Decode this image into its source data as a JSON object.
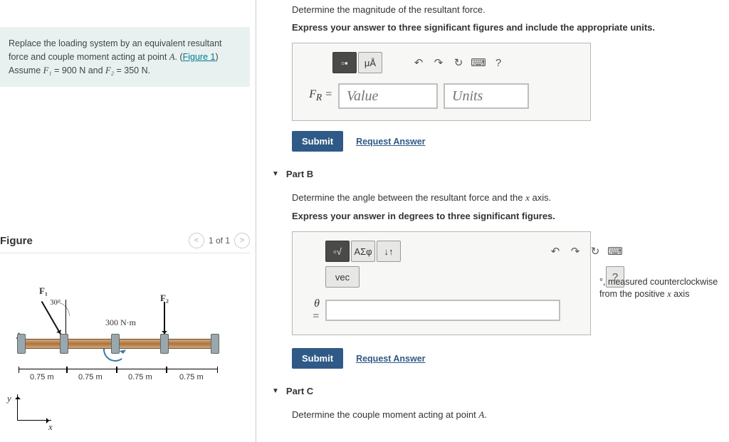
{
  "problem": {
    "intro_prefix": "Replace the loading system by an equivalent resultant force and couple moment acting at point ",
    "point": "A",
    "period": ". (",
    "figure_link": "Figure 1",
    "close": ")",
    "assume_prefix": "Assume ",
    "f1_var": "F₁",
    "f1_eq": " = 900 N and ",
    "f2_var": "F₂",
    "f2_eq": " = 350 N."
  },
  "figure": {
    "title": "Figure",
    "page": "1 of 1",
    "labels": {
      "F1": "F₁",
      "F2": "F₂",
      "angle1": "30°",
      "moment": "300 N·m",
      "A": "A",
      "dim": "0.75 m",
      "x": "x",
      "y": "y"
    }
  },
  "partA": {
    "q1": "Determine the magnitude of the resultant force.",
    "q2": "Express your answer to three significant figures and include the appropriate units.",
    "var_label": "F_R =",
    "value_ph": "Value",
    "units_ph": "Units",
    "toolbar": {
      "units": "μÅ",
      "help": "?"
    }
  },
  "partB": {
    "header": "Part B",
    "q1_prefix": "Determine the angle between the resultant force and the ",
    "q1_var": "x",
    "q1_suffix": " axis.",
    "q2": "Express your answer in degrees to three significant figures.",
    "var_label": "θ =",
    "toolbar": {
      "greek": "ΑΣφ",
      "vec": "vec",
      "help": "?",
      "updown": "↓↑"
    },
    "after_deg": "°",
    "after_text1": ", measured counterclockwise from the positive ",
    "after_var": "x",
    "after_text2": " axis"
  },
  "partC": {
    "header": "Part C",
    "q1_prefix": "Determine the couple moment acting at point ",
    "q1_var": "A",
    "q1_suffix": "."
  },
  "common": {
    "submit": "Submit",
    "request": "Request Answer"
  }
}
